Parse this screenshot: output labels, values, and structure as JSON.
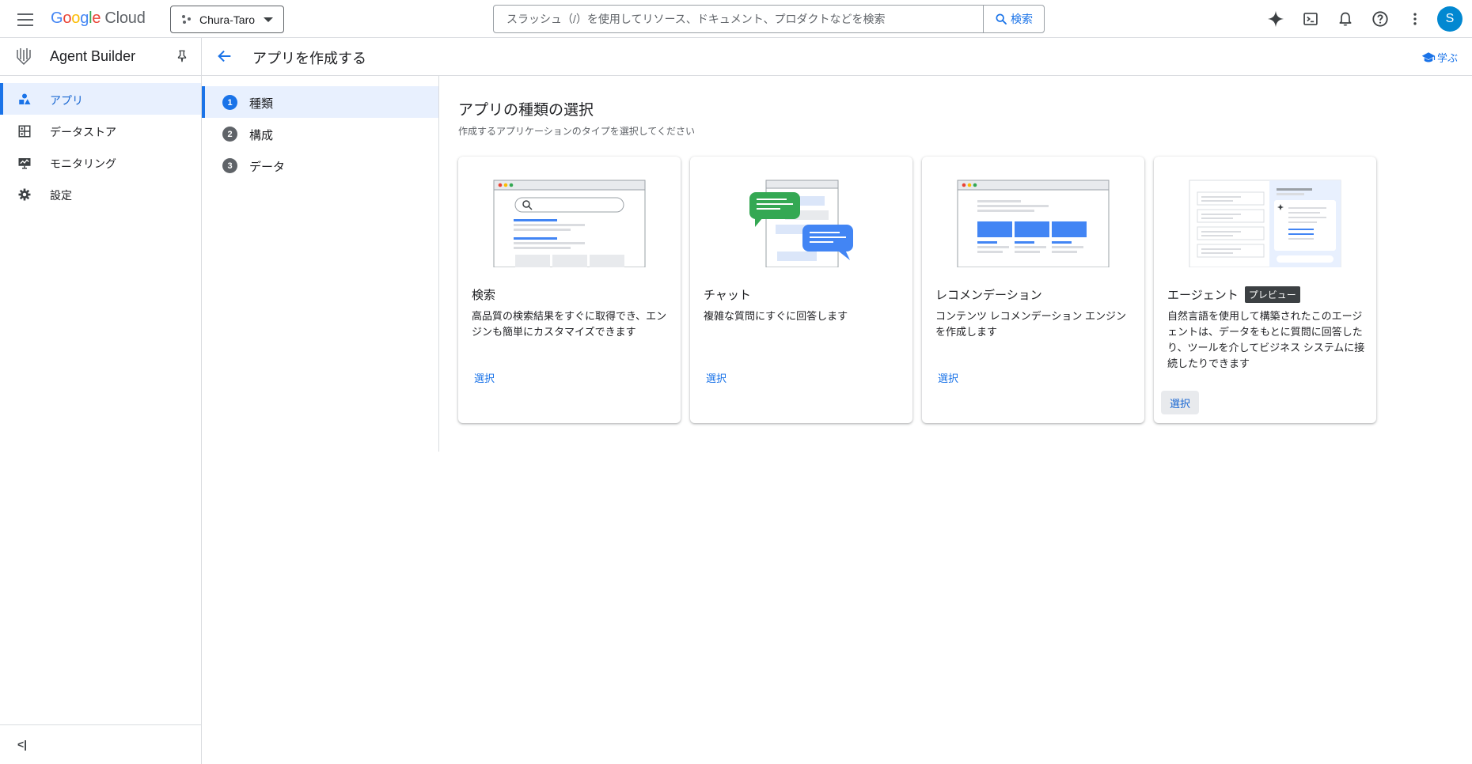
{
  "topbar": {
    "logo_google_letters": [
      "G",
      "o",
      "o",
      "g",
      "l",
      "e"
    ],
    "logo_cloud": "Cloud",
    "project_name": "Chura-Taro",
    "search_placeholder": "スラッシュ（/）を使用してリソース、ドキュメント、プロダクトなどを検索",
    "search_button": "検索",
    "avatar_initial": "S"
  },
  "sidebar": {
    "product_title": "Agent Builder",
    "items": [
      {
        "label": "アプリ",
        "icon": "apps-icon",
        "active": true
      },
      {
        "label": "データストア",
        "icon": "datastore-icon",
        "active": false
      },
      {
        "label": "モニタリング",
        "icon": "monitoring-icon",
        "active": false
      },
      {
        "label": "設定",
        "icon": "settings-icon",
        "active": false
      }
    ],
    "collapse_glyph": "<|"
  },
  "page": {
    "title": "アプリを作成する",
    "learn_label": "学ぶ"
  },
  "stepper": {
    "steps": [
      {
        "number": "1",
        "label": "種類",
        "active": true
      },
      {
        "number": "2",
        "label": "構成",
        "active": false
      },
      {
        "number": "3",
        "label": "データ",
        "active": false
      }
    ]
  },
  "main": {
    "title": "アプリの種類の選択",
    "subtitle": "作成するアプリケーションのタイプを選択してください",
    "cards": [
      {
        "title": "検索",
        "description": "高品質の検索結果をすぐに取得でき、エンジンも簡単にカスタマイズできます",
        "select_label": "選択"
      },
      {
        "title": "チャット",
        "description": "複雑な質問にすぐに回答します",
        "select_label": "選択"
      },
      {
        "title": "レコメンデーション",
        "description": "コンテンツ レコメンデーション エンジンを作成します",
        "select_label": "選択"
      },
      {
        "title": "エージェント",
        "badge": "プレビュー",
        "description": "自然言語を使用して構築されたこのエージェントは、データをもとに質問に回答したり、ツールを介してビジネス システムに接続したりできます",
        "select_label": "選択"
      }
    ]
  },
  "colors": {
    "accent": "#1a73e8",
    "active_bg": "#e8f0fe",
    "border": "#dadce0",
    "avatar": "#0288d1",
    "chat_green": "#34a853",
    "chat_blue": "#4285f4"
  }
}
